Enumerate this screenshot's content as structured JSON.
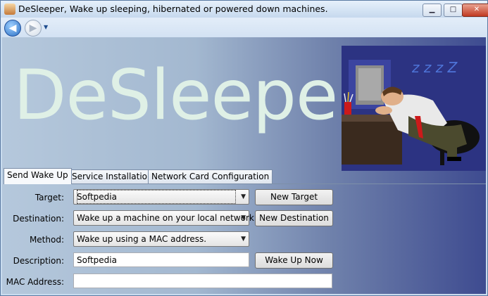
{
  "window": {
    "title": "DeSleeper, Wake up sleeping, hibernated or powered down machines.",
    "minimize_glyph": "▁",
    "maximize_glyph": "□",
    "close_glyph": "✕"
  },
  "nav": {
    "back_glyph": "◀",
    "forward_glyph": "▶",
    "dropdown_glyph": "▼"
  },
  "banner": {
    "title": "DeSleeper",
    "snore": "z z z Z"
  },
  "tabs": [
    {
      "label": "Send Wake Up",
      "active": true
    },
    {
      "label": "Service Installation",
      "active": false
    },
    {
      "label": "Network Card Configuration",
      "active": false
    }
  ],
  "form": {
    "target_label": "Target:",
    "target_value": "Softpedia",
    "destination_label": "Destination:",
    "destination_value": "Wake up a machine on your local network.",
    "method_label": "Method:",
    "method_value": "Wake up using a MAC address.",
    "description_label": "Description:",
    "description_value": "Softpedia",
    "mac_label": "MAC Address:",
    "mac_value": ""
  },
  "buttons": {
    "new_target": "New Target",
    "new_destination": "New Destination",
    "wake_up_now": "Wake Up Now"
  },
  "combo_arrow": "▼",
  "colors": {
    "banner_text": "#dff0e6",
    "accent": "#3e4b90"
  }
}
